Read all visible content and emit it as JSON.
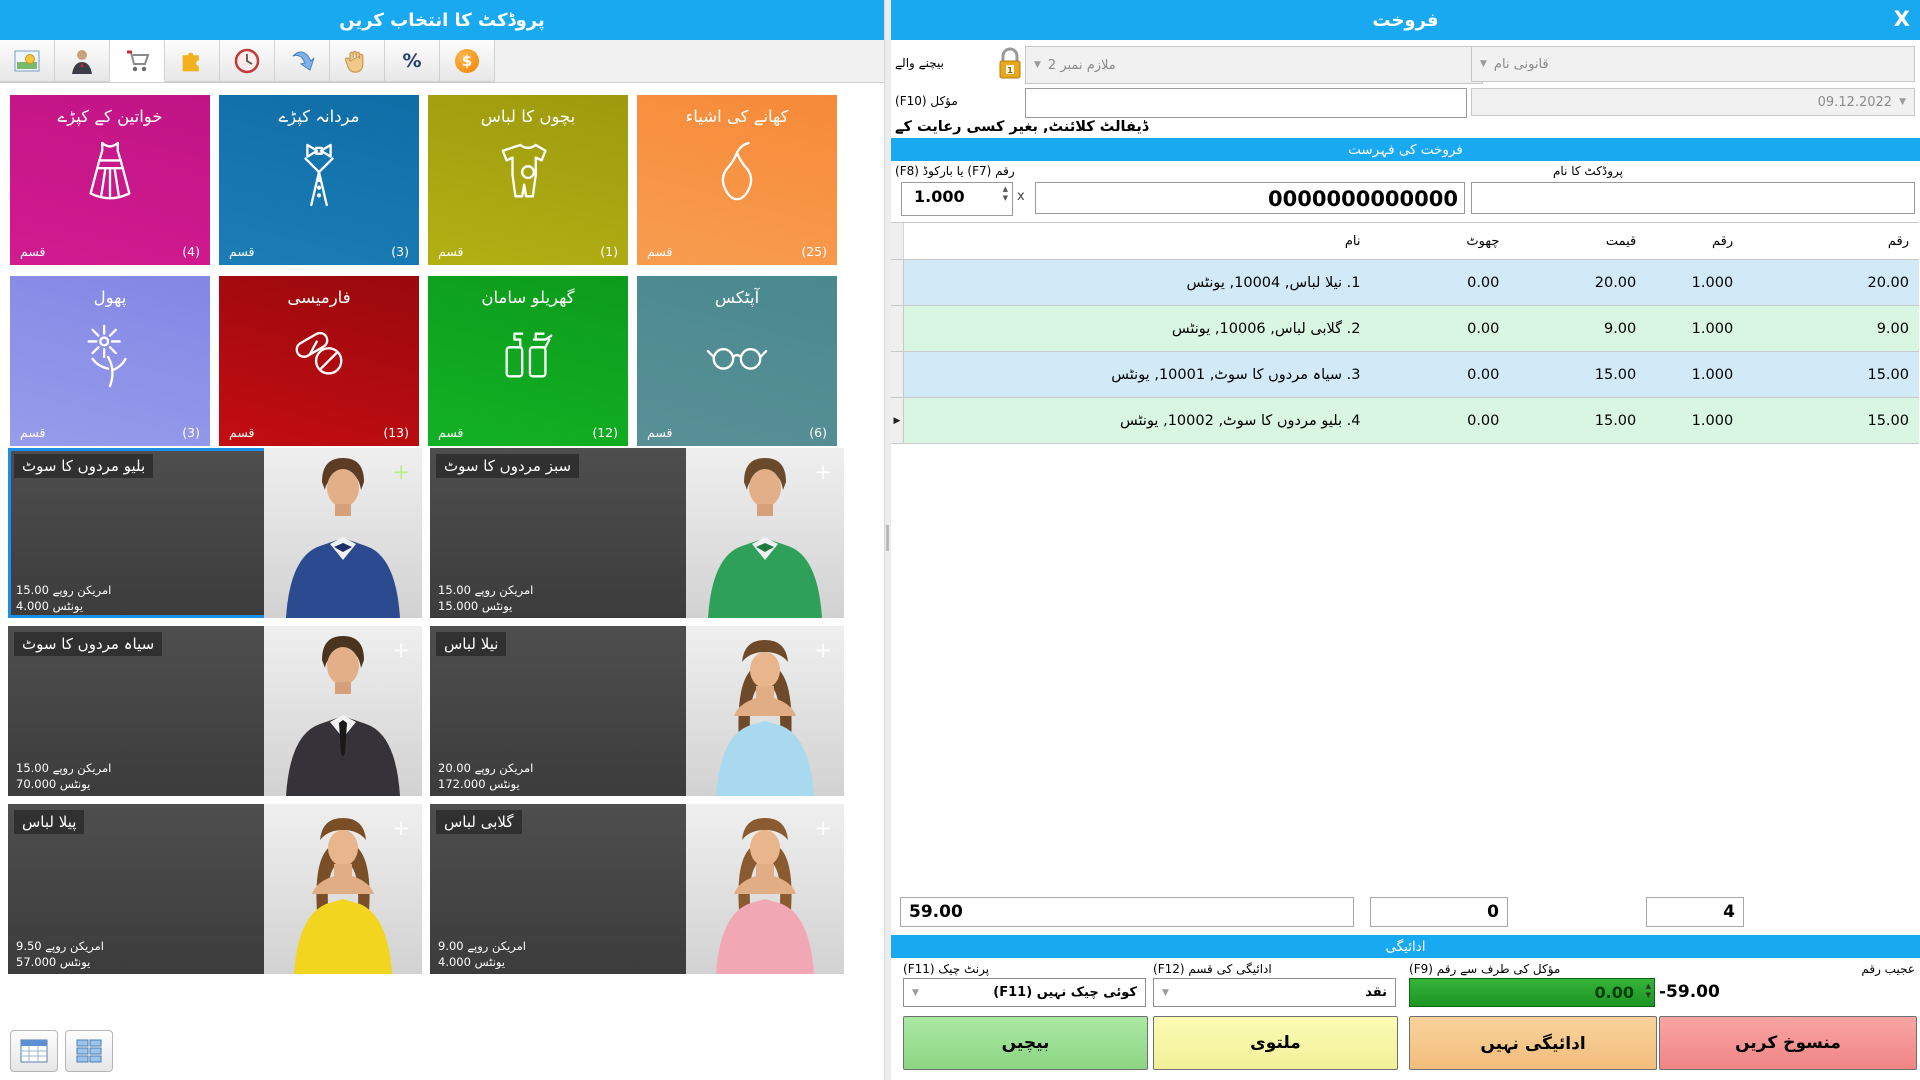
{
  "left": {
    "title": "پروڈکٹ کا انتخاب کریں",
    "toolbar_icons": [
      "picture-icon",
      "person-icon",
      "cart-icon",
      "puzzle-icon",
      "clock-icon",
      "arrow-icon",
      "hand-icon",
      "percent-icon",
      "dollar-icon"
    ],
    "percent_glyph": "%",
    "dollar_glyph": "$",
    "plus": "+",
    "category_tag": "قسم",
    "categories": [
      {
        "name": "خواتین کے کپڑے",
        "count": "(4)"
      },
      {
        "name": "مردانہ کپڑے",
        "count": "(3)"
      },
      {
        "name": "بچوں کا لباس",
        "count": "(1)"
      },
      {
        "name": "کھانے کی اشیاء",
        "count": "(25)"
      },
      {
        "name": "پھول",
        "count": "(3)"
      },
      {
        "name": "فارمیسی",
        "count": "(13)"
      },
      {
        "name": "گھریلو سامان",
        "count": "(12)"
      },
      {
        "name": "آپٹکس",
        "count": "(6)"
      }
    ],
    "products": [
      {
        "name": "بلیو مردوں کا سوٹ",
        "price": "امریکن روپے 15.00",
        "qty": "یونٹس 4.000",
        "selected": true
      },
      {
        "name": "سبز مردوں کا سوٹ",
        "price": "امریکن روپے 15.00",
        "qty": "یونٹس 15.000",
        "selected": false
      },
      {
        "name": "سیاہ مردوں کا سوٹ",
        "price": "امریکن روپے 15.00",
        "qty": "یونٹس 70.000",
        "selected": false
      },
      {
        "name": "نیلا لباس",
        "price": "امریکن روپے 20.00",
        "qty": "یونٹس 172.000",
        "selected": false
      },
      {
        "name": "پیلا لباس",
        "price": "امریکن روپے 9.50",
        "qty": "یونٹس 57.000",
        "selected": false
      },
      {
        "name": "گلابی لباس",
        "price": "امریکن روپے 9.00",
        "qty": "یونٹس 4.000",
        "selected": false
      }
    ],
    "view_buttons": [
      "table-view",
      "tile-view"
    ]
  },
  "right": {
    "title": "فروخت",
    "close_glyph": "X",
    "seller_label": "بیچنے والے",
    "seller_combo_value": "ملازم نمبر 2",
    "legal_name_placeholder": "قانونی نام",
    "client_label": "مؤکل (F10)",
    "client_value": "",
    "date_value": "09.12.2022",
    "default_client_note": "ڈیفالٹ کلائنٹ, بغیر کسی رعایت کے",
    "sale_list_header": "فروخت کی فہرست",
    "barcode_label": "رقم (F7) یا بارکوڈ (F8)",
    "product_name_label": "پروڈکٹ کا نام",
    "qty_value": "1.000",
    "multiply_glyph": "x",
    "barcode_value": "0000000000000",
    "table": {
      "headers": [
        "نام",
        "چھوٹ",
        "قیمت",
        "رقم",
        "رقم"
      ],
      "rows": [
        {
          "name": "1. نیلا لباس, 10004, یونٹس",
          "discount": "0.00",
          "price": "20.00",
          "qty": "1.000",
          "amount": "20.00",
          "current": false
        },
        {
          "name": "2. گلابی لباس, 10006, یونٹس",
          "discount": "0.00",
          "price": "9.00",
          "qty": "1.000",
          "amount": "9.00",
          "current": false
        },
        {
          "name": "3. سیاہ مردوں کا سوٹ, 10001, یونٹس",
          "discount": "0.00",
          "price": "15.00",
          "qty": "1.000",
          "amount": "15.00",
          "current": false
        },
        {
          "name": "4. بلیو مردوں کا سوٹ, 10002, یونٹس",
          "discount": "0.00",
          "price": "15.00",
          "qty": "1.000",
          "amount": "15.00",
          "current": true
        }
      ],
      "current_row_glyph": "▶"
    },
    "totals": {
      "amount": "59.00",
      "discount": "0",
      "quantity": "4"
    },
    "payment_header": "ادائیگی",
    "print_check_label": "پرنٹ چیک (F11)",
    "print_check_value": "کوئی چیک نہیں (F11)",
    "payment_type_label": "ادائیگی کی قسم (F12)",
    "payment_type_value": "نقد",
    "customer_amount_label": "مؤکل کی طرف سے رقم (F9)",
    "customer_amount_value": "0.00",
    "odd_amount_label": "عجیب رقم",
    "odd_amount_value": "-59.00",
    "buttons": {
      "sell": "بیچیں",
      "postpone": "ملتوی",
      "no_payment": "ادائیگی نہیں",
      "cancel": "منسوخ کریں"
    },
    "spinner_up": "▲",
    "spinner_down": "▼",
    "dropdown_glyph": "▼"
  },
  "colors": {
    "header_blue": "#19a9f1",
    "row_blue": "#d2eaf8",
    "row_green": "#d9f6e3",
    "cash_green": "#28a52e",
    "btn_sell": "#9adc92",
    "btn_postpone": "#f6f6a6",
    "btn_no_payment": "#f5c78e",
    "btn_cancel": "#f59494",
    "tile_magenta": "#c91689",
    "tile_blue": "#1474ae",
    "tile_olive": "#a8a511",
    "tile_orange": "#f79144",
    "tile_periwinkle": "#8d91e7",
    "tile_red": "#ad0b10",
    "tile_green": "#10a520",
    "tile_teal": "#518c92",
    "selected_border": "#1b8fe8"
  }
}
